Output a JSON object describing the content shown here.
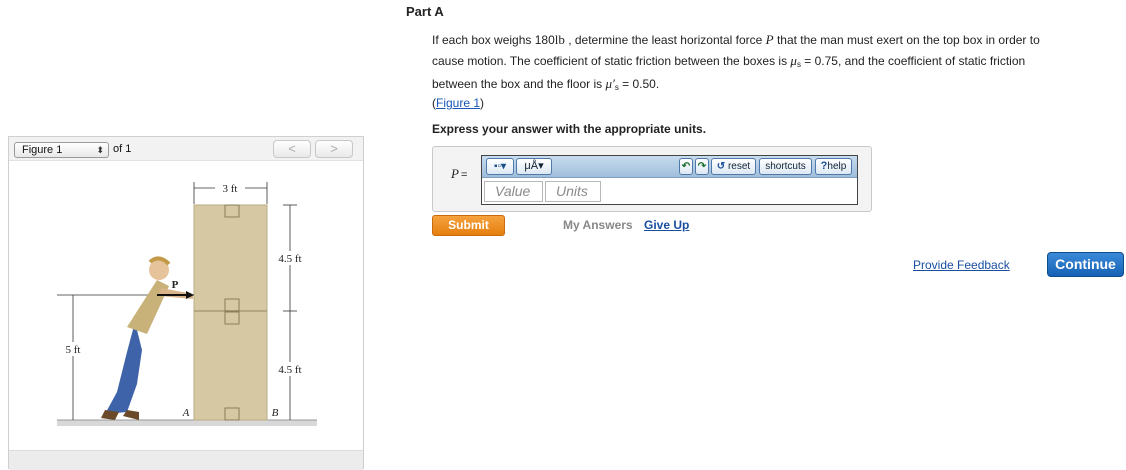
{
  "figure_panel": {
    "selector_label": "Figure 1",
    "of_label": "of",
    "total": "1",
    "prev_glyph": "<",
    "next_glyph": ">",
    "labels": {
      "width": "3 ft",
      "height_top": "4.5 ft",
      "height_bottom": "4.5 ft",
      "man_height": "5 ft",
      "force": "P",
      "point_a": "A",
      "point_b": "B"
    },
    "icons": [
      "updown-arrows-icon",
      "chevron-left-icon",
      "chevron-right-icon"
    ]
  },
  "part": {
    "title": "Part A"
  },
  "question": {
    "line1_a": "If each box weighs 180",
    "unit_lb": "lb",
    "line1_b": " , determine the least horizontal force ",
    "force_symbol": "P",
    "line1_c": " that the man must exert on the top box in order to",
    "line2_a": "cause motion. The coefficient of static friction between the boxes is ",
    "mu": "μ",
    "mu_sub": "s",
    "line2_b": " = 0.75, and the coefficient of static friction",
    "line3_a": "between the box and the floor is ",
    "mu_prime": "μ′",
    "mu_prime_sub": "s",
    "line3_b": " = 0.50."
  },
  "figure_link": {
    "open": "(",
    "label": "Figure 1",
    "close": ")"
  },
  "instruction": "Express your answer with the appropriate units.",
  "answer": {
    "variable": "P",
    "equals": "=",
    "toolbar": {
      "templates_glyph": "▪▫▾",
      "units_label": "μÅ▾",
      "undo_glyph": "↶",
      "redo_glyph": "↷",
      "reset_icon": "↺",
      "reset_label": "reset",
      "shortcuts_label": "shortcuts",
      "help_icon": "?",
      "help_label": "help"
    },
    "value_placeholder": "Value",
    "units_placeholder": "Units"
  },
  "actions": {
    "submit": "Submit",
    "my_answers": "My Answers",
    "give_up": "Give Up",
    "provide_feedback": "Provide Feedback",
    "continue": "Continue"
  },
  "colors": {
    "submit": "#e8841a",
    "continue": "#1e6bc0",
    "link": "#1a4fa0",
    "box_fill": "#d6c8a2",
    "editor_toolbar": "#b3cde6"
  }
}
